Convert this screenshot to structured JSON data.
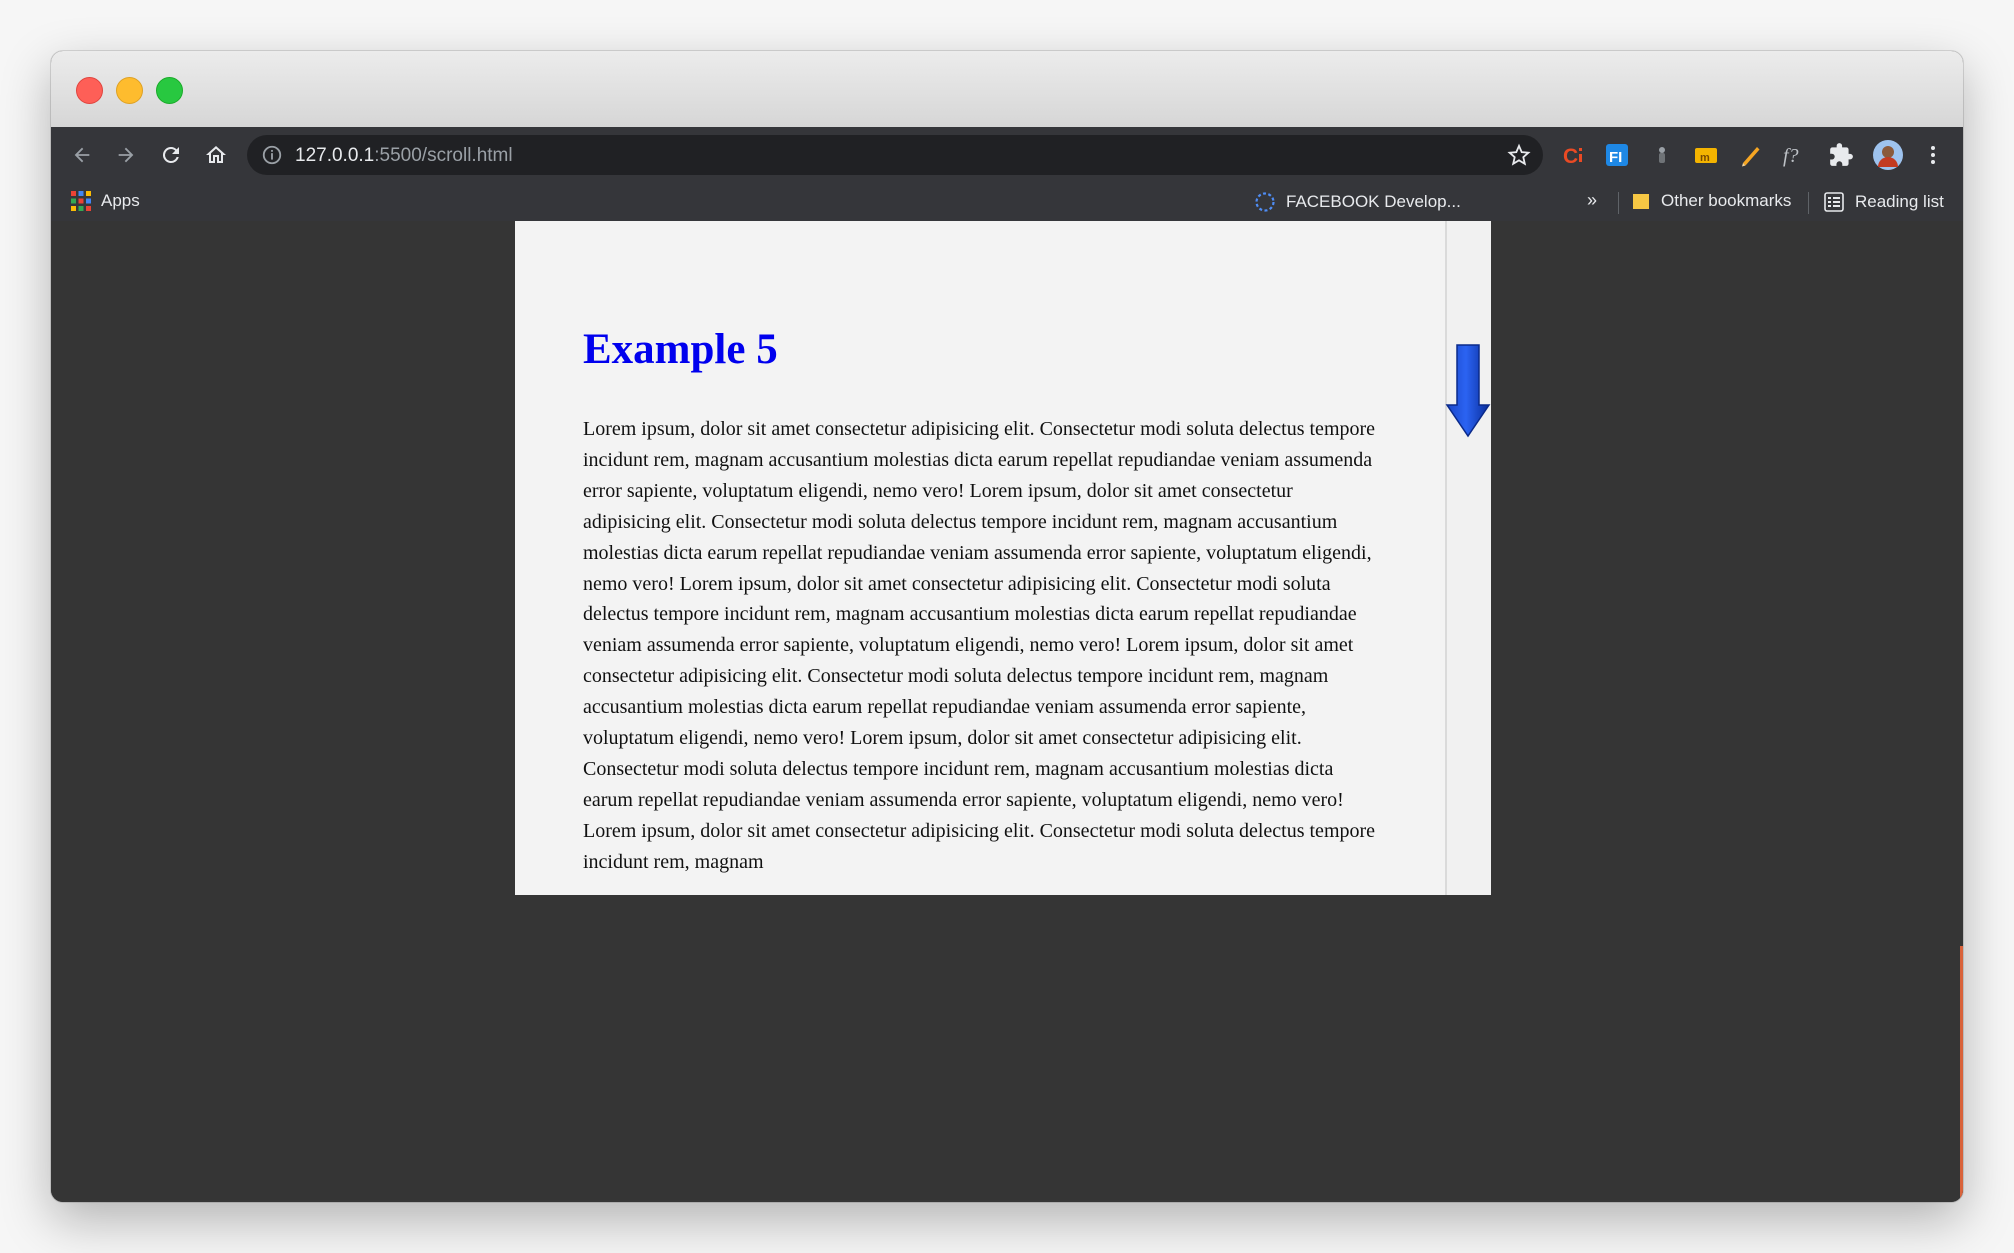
{
  "browser": {
    "url_host": "127.0.0.1",
    "url_path": ":5500/scroll.html"
  },
  "toolbar": {
    "back_icon": "arrow-left-icon",
    "forward_icon": "arrow-right-icon",
    "reload_icon": "reload-icon",
    "home_icon": "home-icon"
  },
  "extensions": [
    "colorzilla-icon",
    "fi-extension-icon",
    "dropper-icon",
    "gmail-ext-icon",
    "pencil-icon",
    "formula-icon",
    "puzzle-icon"
  ],
  "bookmarks": {
    "apps": "Apps",
    "facebook": "FACEBOOK Develop...",
    "chevron": "»",
    "other": "Other bookmarks",
    "reading": "Reading list"
  },
  "page": {
    "title": "Example 5",
    "body": "Lorem ipsum, dolor sit amet consectetur adipisicing elit. Consectetur modi soluta delectus tempore incidunt rem, magnam accusantium molestias dicta earum repellat repudiandae veniam assumenda error sapiente, voluptatum eligendi, nemo vero! Lorem ipsum, dolor sit amet consectetur adipisicing elit. Consectetur modi soluta delectus tempore incidunt rem, magnam accusantium molestias dicta earum repellat repudiandae veniam assumenda error sapiente, voluptatum eligendi, nemo vero! Lorem ipsum, dolor sit amet consectetur adipisicing elit. Consectetur modi soluta delectus tempore incidunt rem, magnam accusantium molestias dicta earum repellat repudiandae veniam assumenda error sapiente, voluptatum eligendi, nemo vero! Lorem ipsum, dolor sit amet consectetur adipisicing elit. Consectetur modi soluta delectus tempore incidunt rem, magnam accusantium molestias dicta earum repellat repudiandae veniam assumenda error sapiente, voluptatum eligendi, nemo vero! Lorem ipsum, dolor sit amet consectetur adipisicing elit. Consectetur modi soluta delectus tempore incidunt rem, magnam accusantium molestias dicta earum repellat repudiandae veniam assumenda error sapiente, voluptatum eligendi, nemo vero! Lorem ipsum, dolor sit amet consectetur adipisicing elit. Consectetur modi soluta delectus tempore incidunt rem, magnam",
    "title_color": "#0000ee"
  }
}
